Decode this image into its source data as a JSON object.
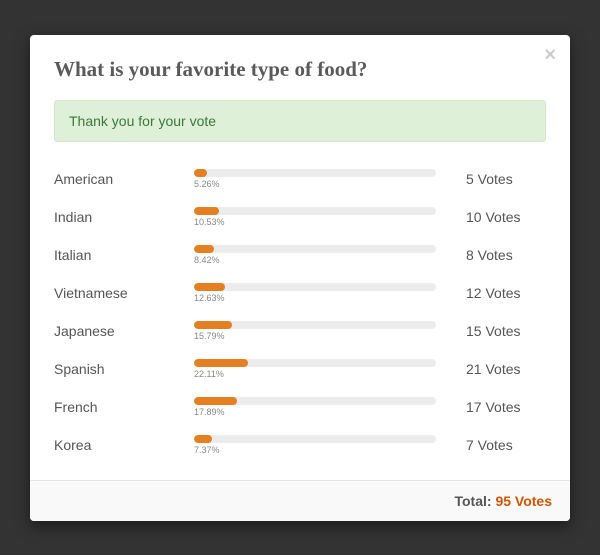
{
  "title": "What is your favorite type of food?",
  "alert": "Thank you for your vote",
  "bar_color": "#e67e22",
  "chart_data": {
    "type": "bar",
    "title": "What is your favorite type of food?",
    "xlabel": "",
    "ylabel": "Votes",
    "categories": [
      "American",
      "Indian",
      "Italian",
      "Vietnamese",
      "Japanese",
      "Spanish",
      "French",
      "Korea"
    ],
    "values": [
      5,
      10,
      8,
      12,
      15,
      21,
      17,
      7
    ],
    "percentages": [
      5.26,
      10.53,
      8.42,
      12.63,
      15.79,
      22.11,
      17.89,
      7.37
    ],
    "total": 95
  },
  "items": [
    {
      "label": "American",
      "pct_text": "5.26%",
      "pct": 5.26,
      "votes_text": "5 Votes"
    },
    {
      "label": "Indian",
      "pct_text": "10.53%",
      "pct": 10.53,
      "votes_text": "10 Votes"
    },
    {
      "label": "Italian",
      "pct_text": "8.42%",
      "pct": 8.42,
      "votes_text": "8 Votes"
    },
    {
      "label": "Vietnamese",
      "pct_text": "12.63%",
      "pct": 12.63,
      "votes_text": "12 Votes"
    },
    {
      "label": "Japanese",
      "pct_text": "15.79%",
      "pct": 15.79,
      "votes_text": "15 Votes"
    },
    {
      "label": "Spanish",
      "pct_text": "22.11%",
      "pct": 22.11,
      "votes_text": "21 Votes"
    },
    {
      "label": "French",
      "pct_text": "17.89%",
      "pct": 17.89,
      "votes_text": "17 Votes"
    },
    {
      "label": "Korea",
      "pct_text": "7.37%",
      "pct": 7.37,
      "votes_text": "7 Votes"
    }
  ],
  "footer": {
    "total_label": "Total: ",
    "total_value": "95 Votes"
  }
}
